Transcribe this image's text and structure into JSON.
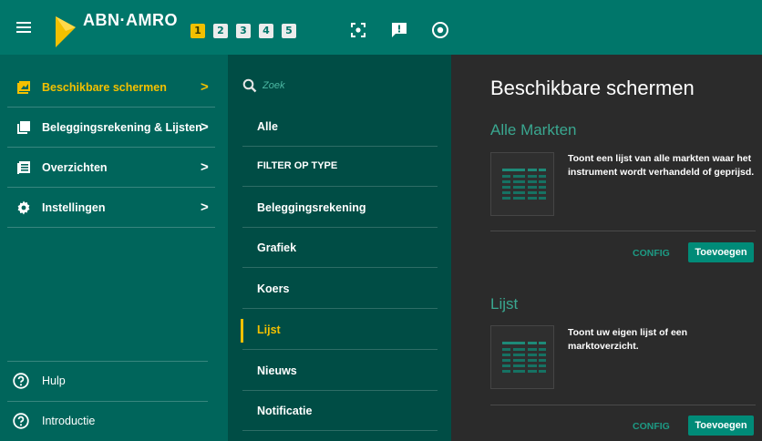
{
  "topbar": {
    "logo_text": "ABN·AMRO",
    "tabs": [
      "1",
      "2",
      "3",
      "4",
      "5"
    ],
    "active_tab": "1",
    "icons": [
      "menu-icon",
      "focus-icon",
      "feedback-icon",
      "record-icon"
    ]
  },
  "sidebar": {
    "items": [
      {
        "label": "Beschikbare schermen",
        "icon": "screens-icon",
        "chevron": ">"
      },
      {
        "label": "Beleggingsrekening & Lijsten",
        "icon": "cards-icon",
        "chevron": ">"
      },
      {
        "label": "Overzichten",
        "icon": "list-icon",
        "chevron": ">"
      },
      {
        "label": "Instellingen",
        "icon": "gear-icon",
        "chevron": ">"
      }
    ],
    "bottom": [
      {
        "label": "Hulp",
        "icon": "help-icon"
      },
      {
        "label": "Introductie",
        "icon": "help-icon"
      }
    ]
  },
  "filter": {
    "search_placeholder": "Zoek",
    "items": [
      "Alle",
      "FILTER OP TYPE",
      "Beleggingsrekening",
      "Grafiek",
      "Koers",
      "Lijst",
      "Nieuws",
      "Notificatie"
    ],
    "active": "Lijst"
  },
  "main": {
    "title": "Beschikbare schermen",
    "cards": [
      {
        "title": "Alle Markten",
        "description": "Toont een lijst van alle markten waar het instrument wordt verhandeld of geprijsd.",
        "config_label": "CONFIG",
        "add_label": "Toevoegen"
      },
      {
        "title": "Lijst",
        "description": "Toont uw eigen lijst of een marktoverzicht.",
        "config_label": "CONFIG",
        "add_label": "Toevoegen"
      }
    ]
  },
  "colors": {
    "topbar": "#00766a",
    "sidebar": "#00655b",
    "filter_panel": "#004d45",
    "content": "#2b2b2b",
    "accent": "#f3c000",
    "teal_text": "#3aa790",
    "button": "#008b78"
  }
}
